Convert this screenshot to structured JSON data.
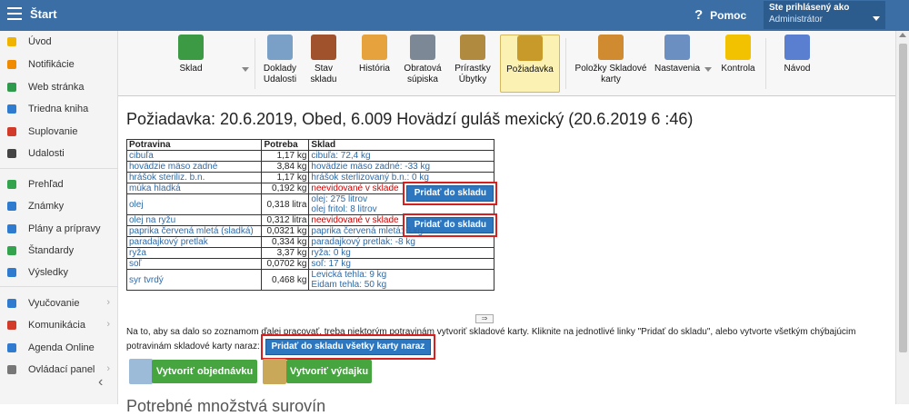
{
  "topbar": {
    "title": "Štart",
    "help": "Pomoc",
    "help_glyph": "?",
    "user_status": "Ste prihlásený ako",
    "user_role": "Administrátor"
  },
  "sidebar": {
    "items": [
      {
        "label": "Úvod",
        "color": "#f0b400"
      },
      {
        "label": "Notifikácie",
        "color": "#f08a00"
      },
      {
        "label": "Web stránka",
        "color": "#2e9a4b"
      },
      {
        "label": "Triedna kniha",
        "color": "#2f7bd0"
      },
      {
        "label": "Suplovanie",
        "color": "#d23b2a"
      },
      {
        "label": "Udalosti",
        "color": "#444444"
      },
      {
        "label": "Prehľad",
        "color": "#33a34d"
      },
      {
        "label": "Známky",
        "color": "#2f7bd0"
      },
      {
        "label": "Plány a prípravy",
        "color": "#2f7bd0"
      },
      {
        "label": "Štandardy",
        "color": "#33a34d"
      },
      {
        "label": "Výsledky",
        "color": "#2f7bd0"
      },
      {
        "label": "Vyučovanie",
        "color": "#2f7bd0"
      },
      {
        "label": "Komunikácia",
        "color": "#d23b2a"
      },
      {
        "label": "Agenda Online",
        "color": "#2f7bd0"
      },
      {
        "label": "Ovládací panel",
        "color": "#777777"
      }
    ]
  },
  "toolbar": {
    "items": [
      {
        "label": "Sklad",
        "color": "#3c9a44"
      },
      {
        "label": "Doklady Udalosti",
        "color": "#7aa0c8"
      },
      {
        "label": "Stav skladu",
        "color": "#a0522d"
      },
      {
        "label": "História",
        "color": "#e6a23c"
      },
      {
        "label": "Obratová súpiska",
        "color": "#7c8896"
      },
      {
        "label": "Prírastky Úbytky",
        "color": "#b08a3e"
      },
      {
        "label": "Požiadavka",
        "color": "#c89a2a"
      },
      {
        "label": "Položky Skladové karty",
        "color": "#d08a30"
      },
      {
        "label": "Nastavenia",
        "color": "#6a8fc0"
      },
      {
        "label": "Kontrola",
        "color": "#f2c200"
      },
      {
        "label": "Návod",
        "color": "#5a7fd0"
      }
    ]
  },
  "page_title": "Požiadavka: 20.6.2019, Obed, 6.009 Hovädzí guláš mexický (20.6.2019   6 :46)",
  "table": {
    "headers": [
      "Potravina",
      "Potreba",
      "Sklad"
    ],
    "rows": [
      {
        "food": "cibuľa",
        "need": "1,17 kg",
        "stock": [
          "cibuľa: 72,4 kg"
        ]
      },
      {
        "food": "hovädzie mäso zadné",
        "need": "3,84 kg",
        "stock": [
          "hovädzie mäso zadné: -33 kg"
        ]
      },
      {
        "food": "hrášok steriliz. b.n.",
        "need": "1,17 kg",
        "stock": [
          "hrášok sterlizovaný b.n.: 0 kg"
        ]
      },
      {
        "food": "múka hladká",
        "need": "0,192 kg",
        "stock_missing": "neevidované v sklade"
      },
      {
        "food": "olej",
        "need": "0,318 litra",
        "stock": [
          "olej: 275 litrov",
          "olej fritol: 8 litrov"
        ]
      },
      {
        "food": "olej na ryžu",
        "need": "0,312 litra",
        "stock_missing": "neevidované v sklade"
      },
      {
        "food": "paprika červená mletá (sladká)",
        "need": "0,0321 kg",
        "stock": [
          "paprika červená mletá: 0 kg"
        ]
      },
      {
        "food": "paradajkový pretlak",
        "need": "0,334 kg",
        "stock": [
          "paradajkový pretlak: -8 kg"
        ]
      },
      {
        "food": "ryža",
        "need": "3,37 kg",
        "stock": [
          "ryža: 0 kg"
        ]
      },
      {
        "food": "soľ",
        "need": "0,0702 kg",
        "stock": [
          "soľ: 17 kg"
        ]
      },
      {
        "food": "syr tvrdý",
        "need": "0,468 kg",
        "stock": [
          "Levická tehla: 9 kg",
          "Eidam tehla: 50 kg"
        ]
      }
    ],
    "add_button": "Pridať do skladu",
    "expand_glyph": "⇒"
  },
  "notice": {
    "text": "Na to, aby sa dalo so zoznamom ďalej pracovať, treba niektorým potravinám vytvoriť skladové karty. Kliknite na jednotlivé linky \"Pridať do skladu\", alebo vytvorte všetkým chýbajúcim potravinám skladové karty naraz:",
    "add_all_button": "Pridať do skladu všetky karty naraz"
  },
  "actions": {
    "create_order": "Vytvoriť objednávku",
    "create_issue": "Vytvoriť výdajku"
  },
  "next_heading": "Potrebné množstvá surovín"
}
